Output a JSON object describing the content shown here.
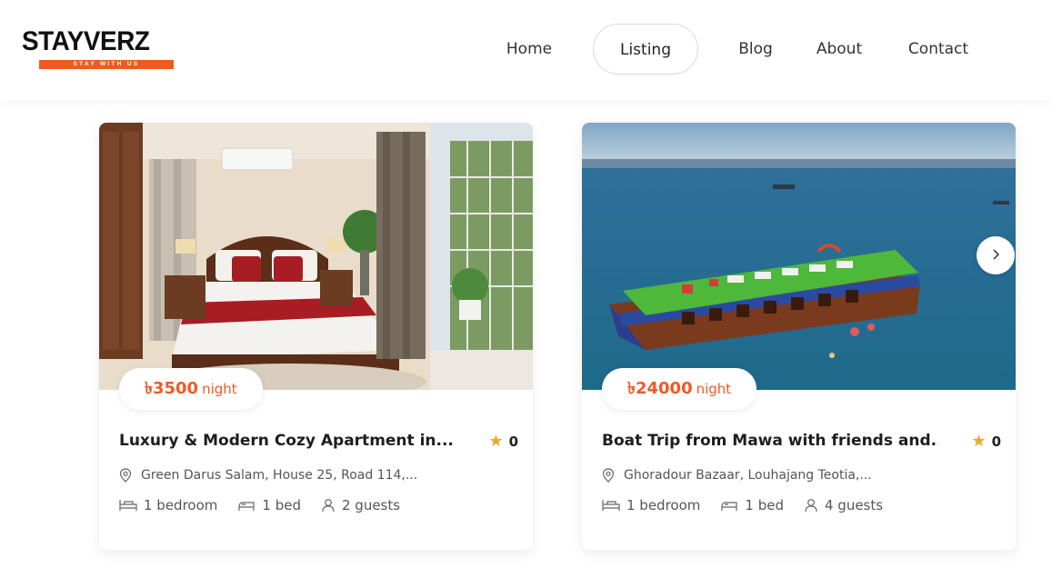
{
  "brand": {
    "name": "STAYVERZ",
    "tagline": "STAY WITH US",
    "accent_color": "#ef5a24"
  },
  "nav": {
    "items": [
      {
        "label": "Home",
        "active": false
      },
      {
        "label": "Listing",
        "active": true
      },
      {
        "label": "Blog",
        "active": false
      },
      {
        "label": "About",
        "active": false
      },
      {
        "label": "Contact",
        "active": false
      }
    ]
  },
  "listings": [
    {
      "price": "৳3500",
      "price_unit": "night",
      "title": "Luxury & Modern Cozy Apartment in...",
      "rating": "0",
      "address": "Green Darus Salam, House 25, Road 114,...",
      "bedrooms": "1 bedroom",
      "beds": "1 bed",
      "guests": "2 guests",
      "image": "bedroom-photo"
    },
    {
      "price": "৳24000",
      "price_unit": "night",
      "title": "Boat Trip from Mawa with friends and...",
      "rating": "0",
      "address": "Ghoradour Bazaar, Louhajang Teotia,...",
      "bedrooms": "1 bedroom",
      "beds": "1 bed",
      "guests": "4 guests",
      "image": "houseboat-photo"
    }
  ],
  "carousel": {
    "next_icon": "chevron-right-icon"
  }
}
